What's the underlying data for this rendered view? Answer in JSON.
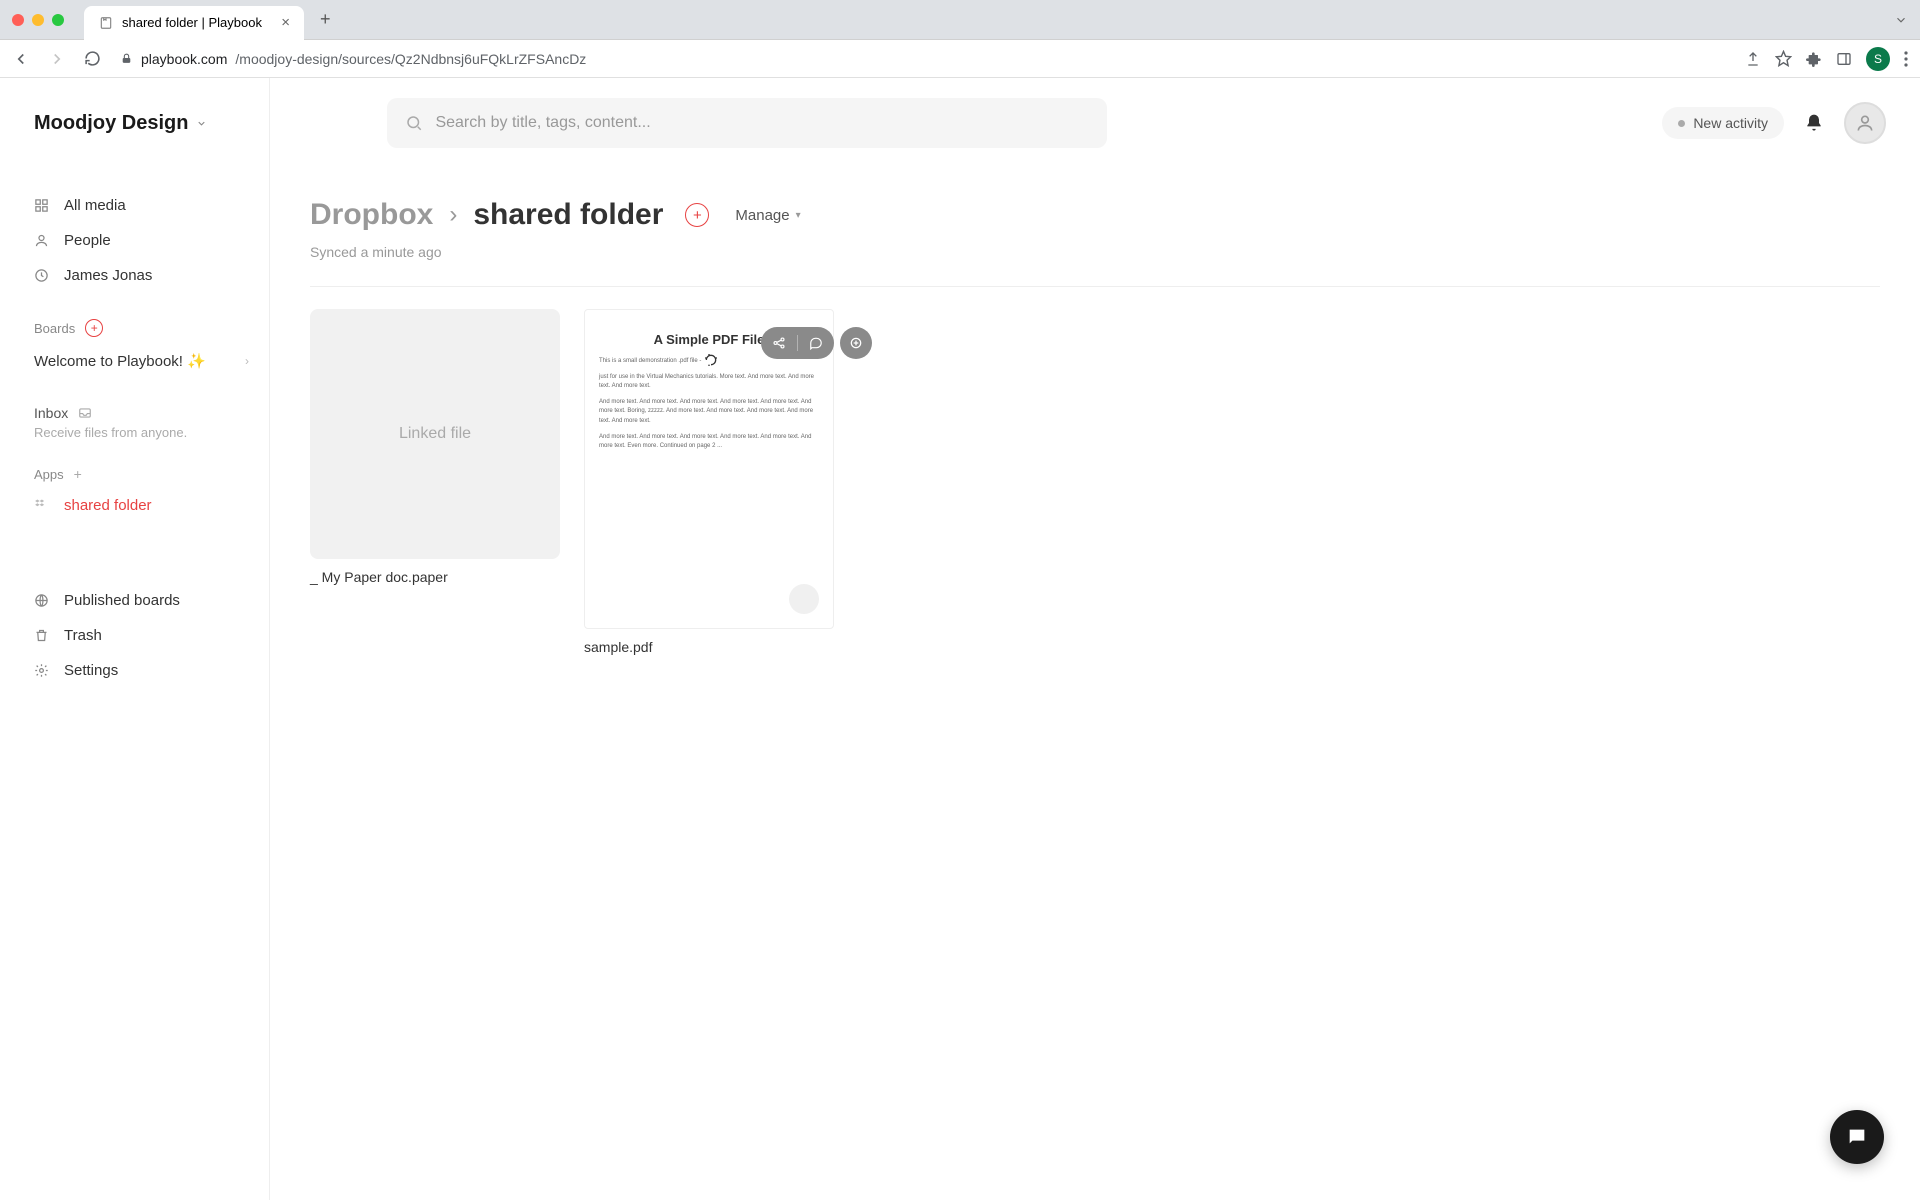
{
  "browser": {
    "tab_title": "shared folder | Playbook",
    "url_host": "playbook.com",
    "url_path": "/moodjoy-design/sources/Qz2Ndbnsj6uFQkLrZFSAncDz",
    "profile_initial": "S"
  },
  "workspace": {
    "name": "Moodjoy Design"
  },
  "search": {
    "placeholder": "Search by title, tags, content..."
  },
  "header_actions": {
    "new_activity": "New activity"
  },
  "sidebar": {
    "nav": [
      {
        "icon": "all-media-icon",
        "label": "All media"
      },
      {
        "icon": "people-icon",
        "label": "People"
      },
      {
        "icon": "clock-icon",
        "label": "James Jonas"
      }
    ],
    "boards_heading": "Boards",
    "boards": [
      {
        "label": "Welcome to Playbook! ✨"
      }
    ],
    "inbox_label": "Inbox",
    "inbox_sub": "Receive files from anyone.",
    "apps_heading": "Apps",
    "apps": [
      {
        "icon": "dropbox-icon",
        "label": "shared folder",
        "active": true
      }
    ],
    "bottom": [
      {
        "icon": "globe-icon",
        "label": "Published boards"
      },
      {
        "icon": "trash-icon",
        "label": "Trash"
      },
      {
        "icon": "settings-icon",
        "label": "Settings"
      }
    ]
  },
  "breadcrumb": {
    "root": "Dropbox",
    "current": "shared folder",
    "manage": "Manage"
  },
  "sync_status": "Synced a minute ago",
  "files": [
    {
      "thumb_text": "Linked file",
      "name": "_ My Paper doc.paper"
    },
    {
      "pdf_title": "A Simple PDF File",
      "name": "sample.pdf"
    }
  ],
  "pdf_preview_lines": [
    "This is a small demonstration .pdf file -",
    "just for use in the Virtual Mechanics tutorials. More text. And more text. And more text. And more text.",
    "And more text. And more text. And more text. And more text. And more text. And more text. Boring, zzzzz. And more text. And more text. And more text. And more text. And more text.",
    "And more text. And more text. And more text. And more text. And more text. And more text. Even more. Continued on page 2 ..."
  ]
}
